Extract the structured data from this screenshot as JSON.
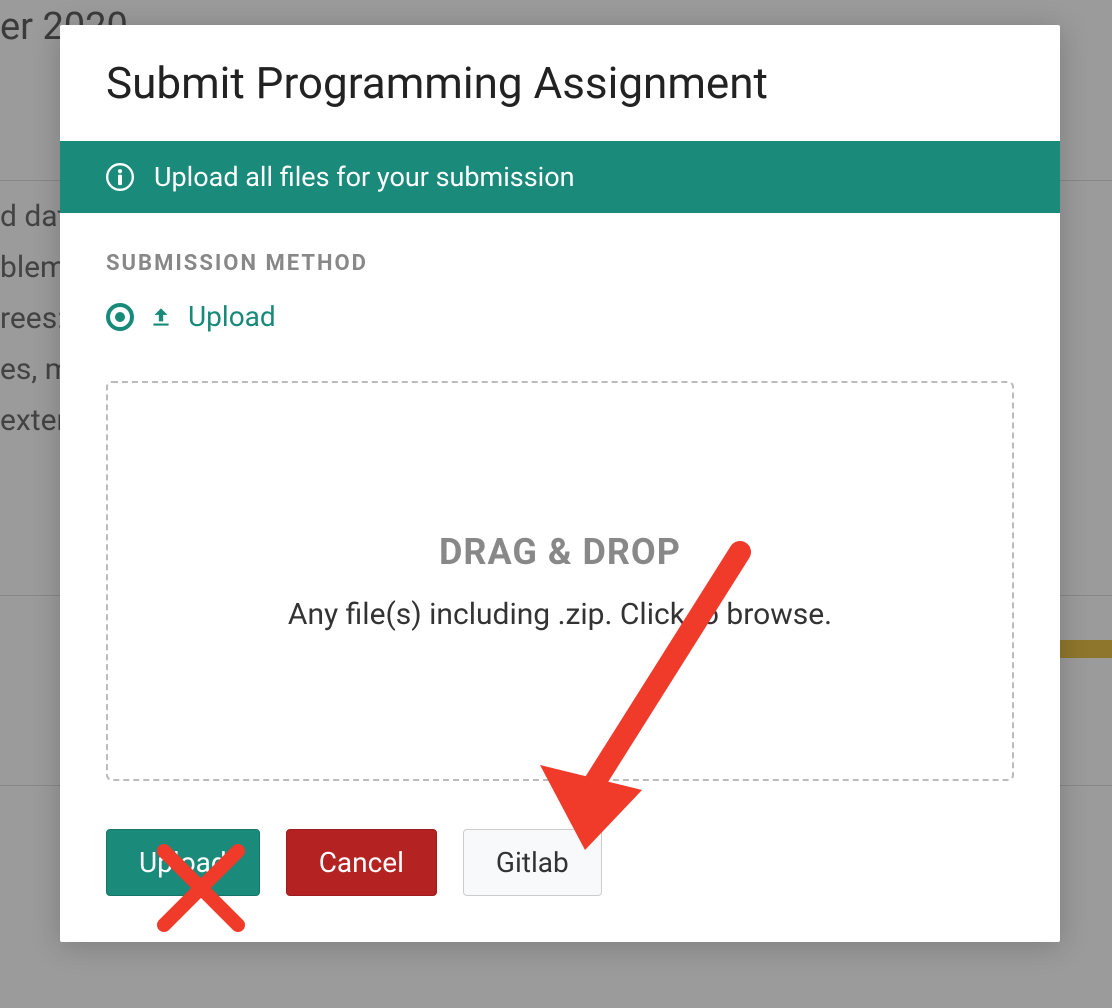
{
  "background": {
    "title_fragment": "er 2020",
    "lines": [
      "d dat",
      "blems",
      "rees:",
      "es, m",
      "exten"
    ]
  },
  "modal": {
    "title": "Submit Programming Assignment",
    "banner_text": "Upload all files for your submission",
    "section_label": "SUBMISSION METHOD",
    "method_label": "Upload",
    "dropzone": {
      "title": "DRAG & DROP",
      "subtitle": "Any file(s) including .zip. Click to browse."
    },
    "buttons": {
      "upload": "Upload",
      "cancel": "Cancel",
      "gitlab": "Gitlab"
    }
  },
  "colors": {
    "teal": "#1a8a7a",
    "red": "#b52222",
    "annotation_red": "#f03a2a"
  }
}
